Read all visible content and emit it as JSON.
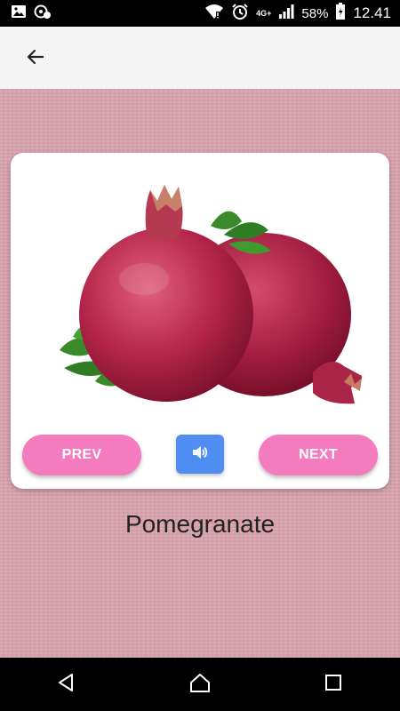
{
  "status_bar": {
    "network": "4G+",
    "battery": "58%",
    "time": "12.41",
    "icons": [
      "image-icon",
      "app-notification-icon",
      "wifi-icon",
      "alarm-icon",
      "signal-icon",
      "battery-icon"
    ]
  },
  "app_bar": {
    "back_icon": "arrow-left-icon"
  },
  "card": {
    "image": "pomegranate-image",
    "prev_label": "PREV",
    "next_label": "NEXT",
    "sound_icon": "speaker-icon"
  },
  "fruit_name": "Pomegranate",
  "colors": {
    "background": "#d9a3ae",
    "pill_button": "#f47bbd",
    "sound_button": "#4f8df2",
    "app_bar": "#f5f5f5"
  },
  "nav_bar": {
    "icons": [
      "back-triangle-icon",
      "home-icon",
      "recents-square-icon"
    ]
  }
}
